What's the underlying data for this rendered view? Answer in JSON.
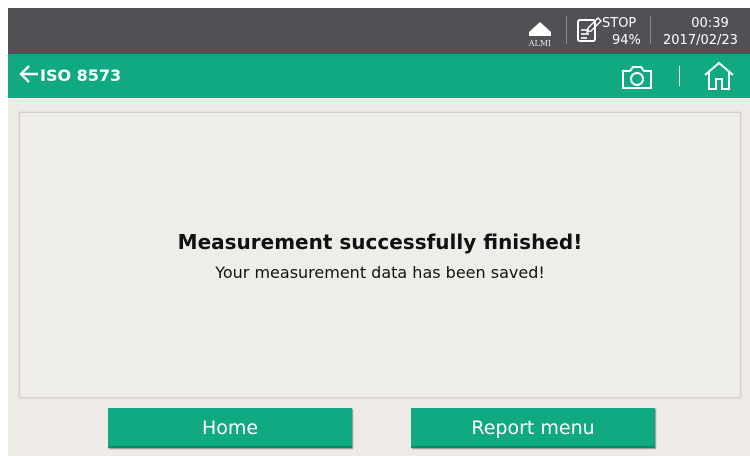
{
  "statusbar": {
    "alarm_label": "ALMI",
    "log_state": "STOP",
    "battery": "94%",
    "time": "00:39",
    "date": "2017/02/23"
  },
  "titlebar": {
    "title": "ISO 8573",
    "back_icon": "arrow-left-icon",
    "screenshot_icon": "camera-icon",
    "home_icon": "home-icon"
  },
  "message": {
    "title": "Measurement successfully finished!",
    "subtitle": "Your measurement data has been saved!"
  },
  "buttons": {
    "home": "Home",
    "report_menu": "Report menu"
  },
  "colors": {
    "accent": "#10a981",
    "statusbar": "#505055",
    "background": "#eeeae6"
  }
}
